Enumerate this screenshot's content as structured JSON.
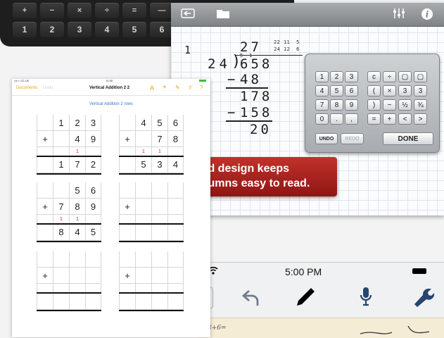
{
  "keyboard": {
    "row1": [
      "+",
      "−",
      "×",
      "÷",
      "=",
      "—"
    ],
    "row2": [
      "1",
      "2",
      "3",
      "4",
      "5",
      "6"
    ]
  },
  "division_app": {
    "quotient": "27",
    "quotient_fraction_num": "22",
    "quotient_fraction_den": "24",
    "quotient_fraction_simpl_num": "11",
    "quotient_fraction_simpl_den": "12",
    "quotient_fraction_small_num": "5",
    "quotient_fraction_small_den": "6",
    "row_number": "1",
    "divisor": "24",
    "dividend": "658",
    "borrow_small_1": "5",
    "borrow_small_2": "1",
    "sub1": "48",
    "rem1": "178",
    "sub2": "158",
    "rem2": "20",
    "banner_line1": "id design keeps",
    "banner_line2": "lumns easy to read.",
    "keypad": {
      "row1": [
        "1",
        "2",
        "3",
        "c",
        "÷",
        "▢",
        "▢"
      ],
      "row2": [
        "4",
        "5",
        "6",
        "(",
        "×",
        "3",
        "3"
      ],
      "row3": [
        "7",
        "8",
        "9",
        ")",
        "−",
        "½",
        "¾"
      ],
      "row4": [
        "0",
        ".",
        ",",
        "=",
        "+",
        "<",
        ">"
      ],
      "undo": "UNDO",
      "redo": "REDO",
      "done": "DONE"
    }
  },
  "phone": {
    "time": "5:00 PM",
    "paper_text": "3+6="
  },
  "ipad": {
    "status_left": "••••○ O2-UK",
    "status_time": "14:38",
    "nav_documents": "Documents",
    "nav_undo": "Undo",
    "title": "Vertical Addition 2 2",
    "sheet_title": "Vertical Addition 2 rows",
    "problems": [
      {
        "top": [
          "",
          "1",
          "2",
          "3"
        ],
        "mid": [
          "+",
          "",
          "4",
          "9"
        ],
        "carry": [
          "",
          "",
          "1",
          ""
        ],
        "ans": [
          "",
          "1",
          "7",
          "2"
        ]
      },
      {
        "top": [
          "",
          "4",
          "5",
          "6"
        ],
        "mid": [
          "+",
          "",
          "7",
          "8"
        ],
        "carry": [
          "",
          "1",
          "1",
          ""
        ],
        "ans": [
          "",
          "5",
          "3",
          "4"
        ]
      },
      {
        "top": [
          "",
          "",
          "5",
          "6"
        ],
        "mid": [
          "+",
          "7",
          "8",
          "9"
        ],
        "carry": [
          "",
          "1",
          "1",
          ""
        ],
        "ans": [
          "",
          "8",
          "4",
          "5"
        ]
      },
      {
        "top": [
          "",
          "",
          "",
          ""
        ],
        "mid": [
          "+",
          "",
          "",
          ""
        ],
        "carry": [
          "",
          "",
          "",
          ""
        ],
        "ans": [
          "",
          "",
          "",
          ""
        ]
      },
      {
        "top": [
          "",
          "",
          "",
          ""
        ],
        "mid": [
          "+",
          "",
          "",
          ""
        ],
        "carry": [
          "",
          "",
          "",
          ""
        ],
        "ans": [
          "",
          "",
          "",
          ""
        ]
      },
      {
        "top": [
          "",
          "",
          "",
          ""
        ],
        "mid": [
          "+",
          "",
          "",
          ""
        ],
        "carry": [
          "",
          "",
          "",
          ""
        ],
        "ans": [
          "",
          "",
          "",
          ""
        ]
      }
    ]
  }
}
